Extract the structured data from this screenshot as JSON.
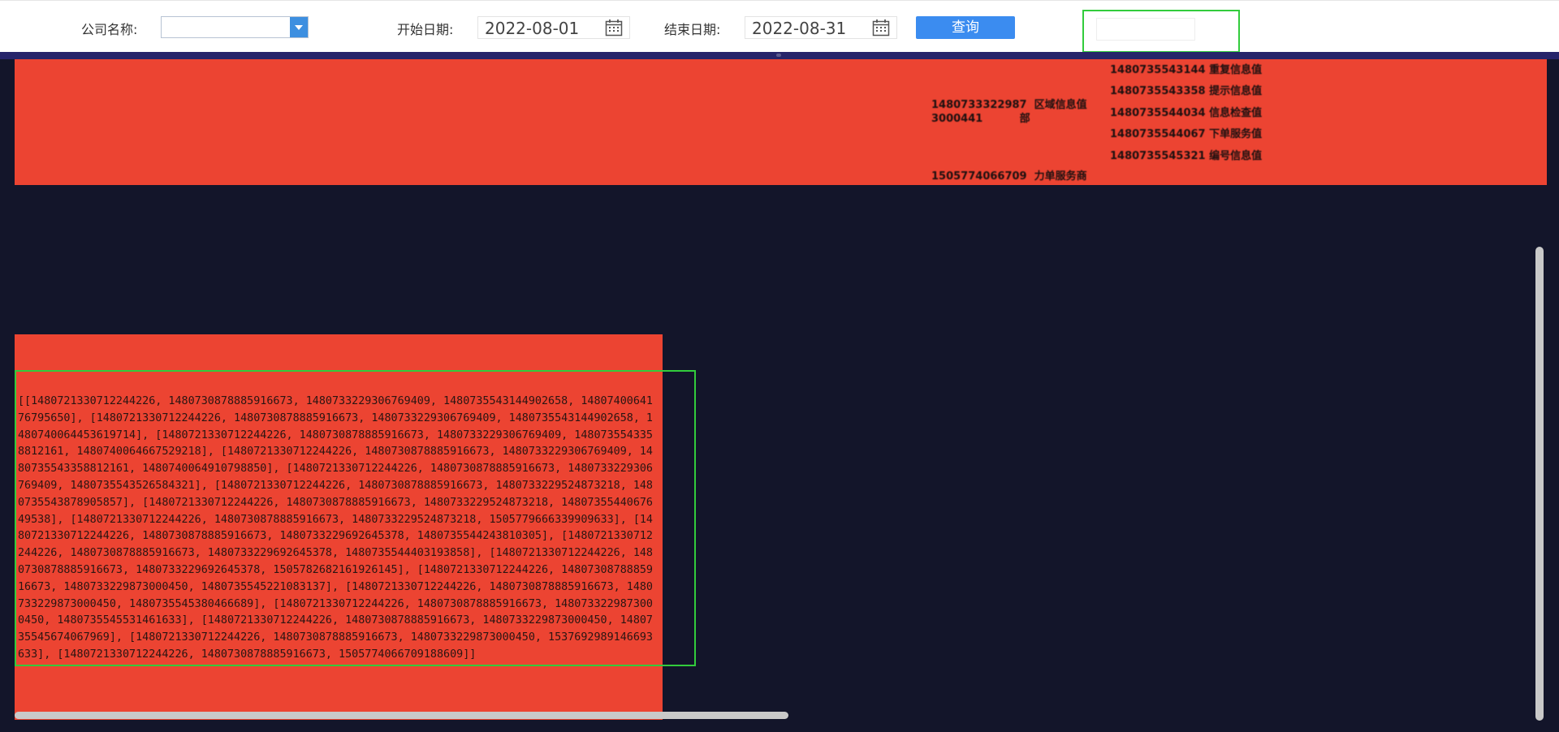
{
  "toolbar": {
    "company_label": "公司名称:",
    "company_value": "",
    "start_label": "开始日期:",
    "start_value": "2022-08-01",
    "end_label": "结束日期:",
    "end_value": "2022-08-31",
    "query_label": "查询",
    "accent_color": "#3b8cf0"
  },
  "top_panel": {
    "background": "#ec4432",
    "rows_left": [
      {
        "id": "1480733322987",
        "text": "区域信息值"
      },
      {
        "id": "3000441",
        "text": "部"
      },
      {
        "id": "1505774066709",
        "text": "力单服务商"
      }
    ],
    "rows_right": [
      {
        "id": "1480735543144",
        "text": "重复信息值"
      },
      {
        "id": "1480735543358",
        "text": "提示信息值"
      },
      {
        "id": "1480735544034",
        "text": "信息检查值"
      },
      {
        "id": "1480735544067",
        "text": "下单服务值"
      },
      {
        "id": "1480735545321",
        "text": "编号信息值"
      }
    ]
  },
  "bottom_panel": {
    "background": "#ec4432",
    "id_dump": "[[1480721330712244226, 1480730878885916673, 1480733229306769409, 1480735543144902658, 1480740064176795650], [1480721330712244226, 1480730878885916673, 1480733229306769409, 1480735543144902658, 1480740064453619714], [1480721330712244226, 1480730878885916673, 1480733229306769409, 1480735543358812161, 1480740064667529218], [1480721330712244226, 1480730878885916673, 1480733229306769409, 1480735543358812161, 1480740064910798850], [1480721330712244226, 1480730878885916673, 1480733229306769409, 1480735543526584321], [1480721330712244226, 1480730878885916673, 1480733229524873218, 1480735543878905857], [1480721330712244226, 1480730878885916673, 1480733229524873218, 1480735544067649538], [1480721330712244226, 1480730878885916673, 1480733229524873218, 1505779666339909633], [1480721330712244226, 1480730878885916673, 1480733229692645378, 1480735544243810305], [1480721330712244226, 1480730878885916673, 1480733229692645378, 1480735544403193858], [1480721330712244226, 1480730878885916673, 1480733229692645378, 1505782682161926145], [1480721330712244226, 1480730878885916673, 1480733229873000450, 1480735545221083137], [1480721330712244226, 1480730878885916673, 1480733229873000450, 1480735545380466689], [1480721330712244226, 1480730878885916673, 1480733229873000450, 1480735545531461633], [1480721330712244226, 1480730878885916673, 1480733229873000450, 1480735545674067969], [1480721330712244226, 1480730878885916673, 1480733229873000450, 1537692989146693633], [1480721330712244226, 1480730878885916673, 1505774066709188609]]"
  },
  "icons": {
    "calendar": "calendar-icon",
    "dropdown": "chevron-down-icon"
  }
}
